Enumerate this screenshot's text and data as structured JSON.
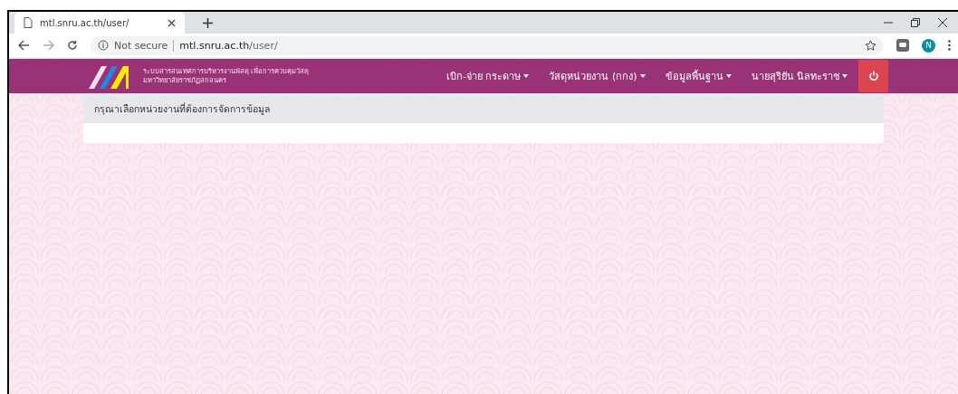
{
  "browser": {
    "tab_title": "mtl.snru.ac.th/user/",
    "security": "Not secure",
    "url_host": "mtl.snru.ac.th",
    "url_path": "/user/",
    "profile_initial": "N"
  },
  "site": {
    "title_line_1": "ระบบสารสนเทศการบริหารงานพัสดุ เพื่อการควบคุมวัสดุ",
    "title_line_2": "มหาวิทยาลัยราชภัฏสกลนคร",
    "menu": [
      {
        "label": "เบิก-จ่าย กระดาษ"
      },
      {
        "label": "วัสดุหน่วยงาน (กกง)"
      },
      {
        "label": "ข้อมูลพื้นฐาน"
      },
      {
        "label": "นายสุริยัน นิลทะราช"
      }
    ]
  },
  "card": {
    "heading": "กรุณาเลือกหน่วยงานที่ต้องการจัดการข้อมูล"
  }
}
